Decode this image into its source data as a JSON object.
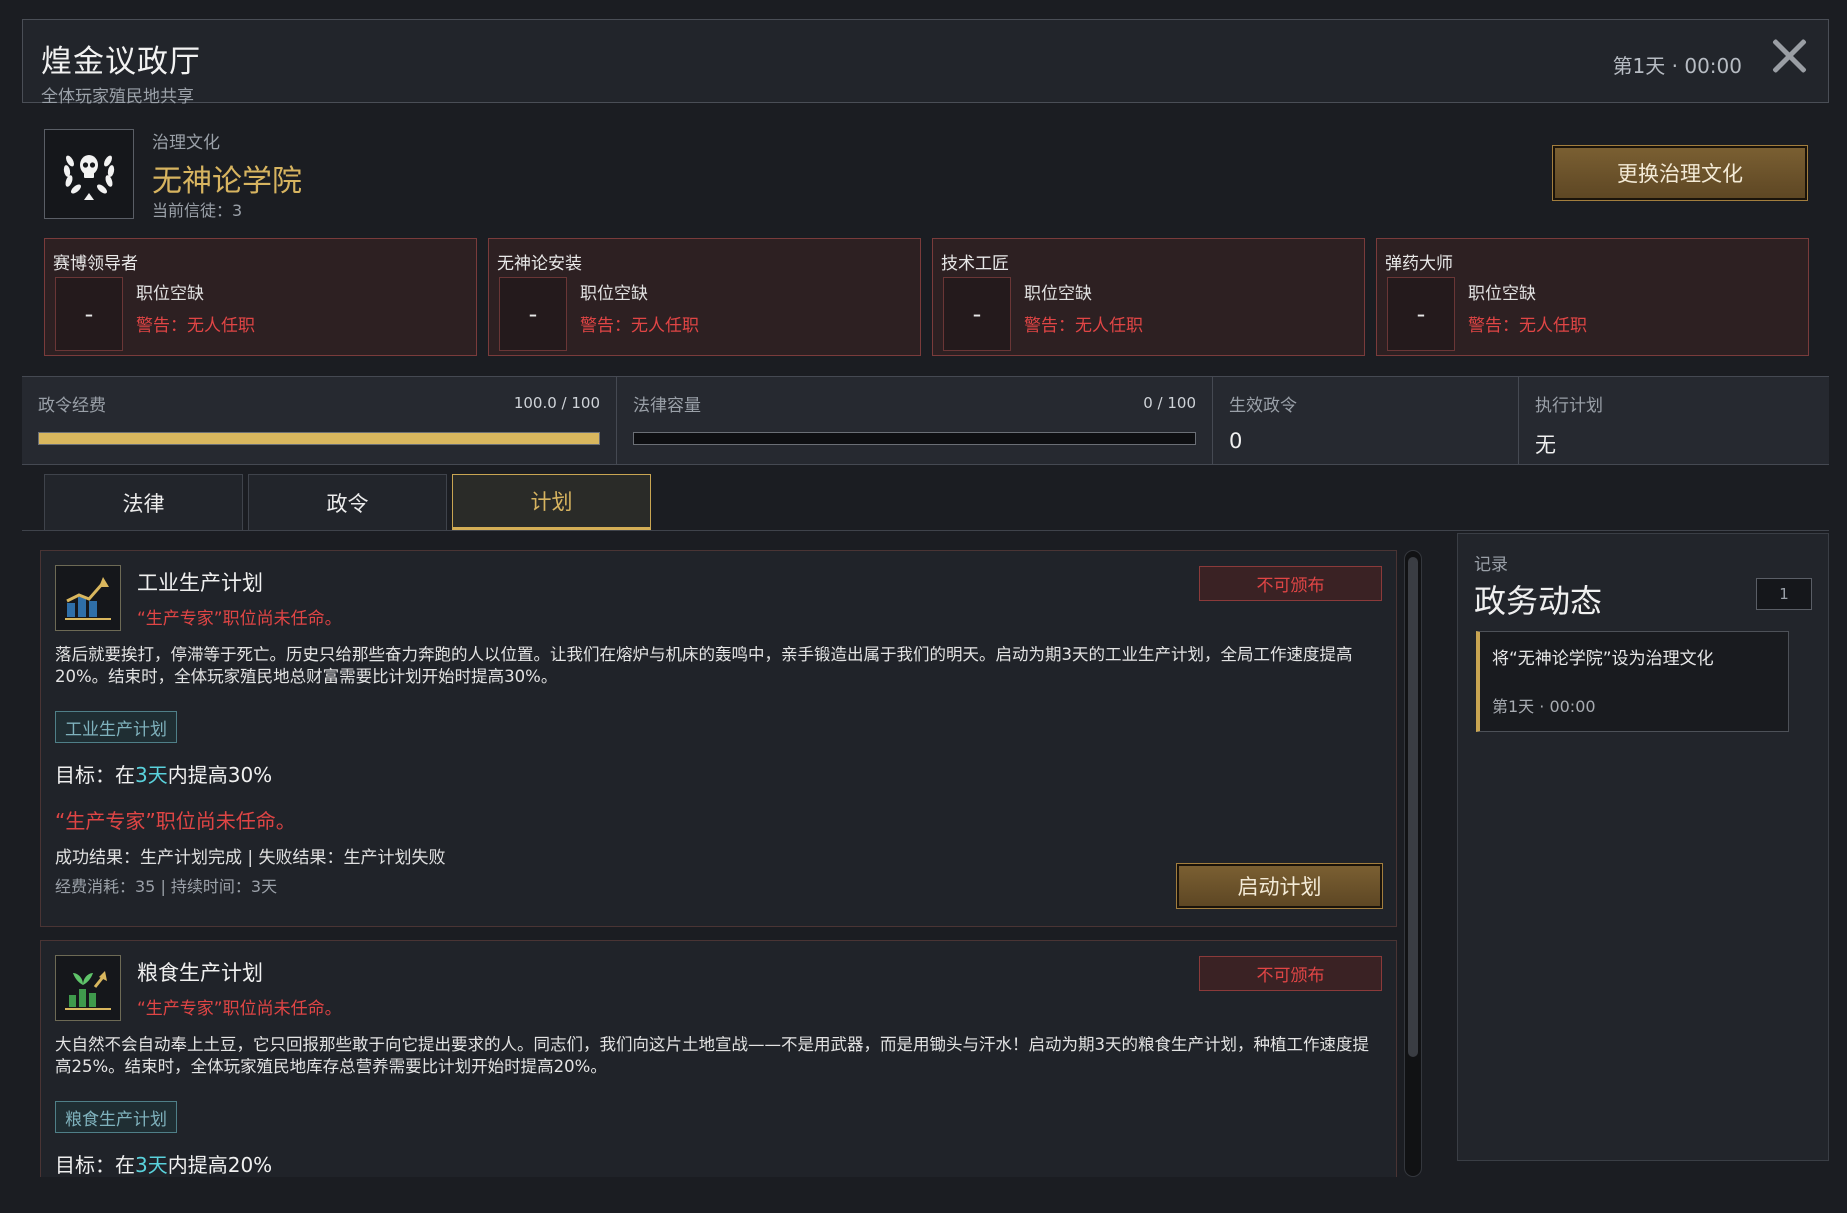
{
  "header": {
    "title": "煌金议政厅",
    "subtitle": "全体玩家殖民地共享",
    "time": "第1天 · 00:00"
  },
  "culture": {
    "label": "治理文化",
    "name": "无神论学院",
    "believers": "当前信徒：3",
    "change_button": "更换治理文化",
    "emblem_icon": "laurel-skull-icon"
  },
  "positions": [
    {
      "title": "赛博领导者",
      "slot": "-",
      "status": "职位空缺",
      "warning": "警告：无人任职"
    },
    {
      "title": "无神论安装",
      "slot": "-",
      "status": "职位空缺",
      "warning": "警告：无人任职"
    },
    {
      "title": "技术工匠",
      "slot": "-",
      "status": "职位空缺",
      "warning": "警告：无人任职"
    },
    {
      "title": "弹药大师",
      "slot": "-",
      "status": "职位空缺",
      "warning": "警告：无人任职"
    }
  ],
  "stats": {
    "decree_funds": {
      "label": "政令经费",
      "value": "100.0 / 100",
      "fill": 1.0
    },
    "law_capacity": {
      "label": "法律容量",
      "value": "0 / 100",
      "fill": 0.0
    },
    "active_decrees": {
      "label": "生效政令",
      "value": "0"
    },
    "exec_plan": {
      "label": "执行计划",
      "value": "无"
    }
  },
  "tabs": [
    {
      "label": "法律",
      "active": false
    },
    {
      "label": "政令",
      "active": false
    },
    {
      "label": "计划",
      "active": true
    }
  ],
  "plans": [
    {
      "icon": "industry-chart-icon",
      "name": "工业生产计划",
      "requirement": "“生产专家”职位尚未任命。",
      "badge": "不可颁布",
      "description": "落后就要挨打，停滞等于死亡。历史只给那些奋力奔跑的人以位置。让我们在熔炉与机床的轰鸣中，亲手锻造出属于我们的明天。启动为期3天的工业生产计划，全局工作速度提高20%。结束时，全体玩家殖民地总财富需要比计划开始时提高30%。",
      "tag": "工业生产计划",
      "target_prefix": "目标：在",
      "target_days": "3天",
      "target_suffix": "内提高30%",
      "requirement_big": "“生产专家”职位尚未任命。",
      "results": "成功结果：生产计划完成 | 失败结果：生产计划失败",
      "cost": "经费消耗：35 | 持续时间：3天",
      "start_button": "启动计划"
    },
    {
      "icon": "crop-chart-icon",
      "name": "粮食生产计划",
      "requirement": "“生产专家”职位尚未任命。",
      "badge": "不可颁布",
      "description": "大自然不会自动奉上土豆，它只回报那些敢于向它提出要求的人。同志们，我们向这片土地宣战——不是用武器，而是用锄头与汗水！启动为期3天的粮食生产计划，种植工作速度提高25%。结束时，全体玩家殖民地库存总营养需要比计划开始时提高20%。",
      "tag": "粮食生产计划",
      "target_prefix": "目标：在",
      "target_days": "3天",
      "target_suffix": "内提高20%"
    }
  ],
  "log": {
    "small_label": "记录",
    "title": "政务动态",
    "count": "1",
    "entries": [
      {
        "text": "将“无神论学院”设为治理文化",
        "time": "第1天 · 00:00"
      }
    ]
  },
  "colors": {
    "accent_gold": "#d7b460",
    "warning_red": "#e04545",
    "highlight_cyan": "#5ad2dc",
    "background": "#1b1d22"
  }
}
